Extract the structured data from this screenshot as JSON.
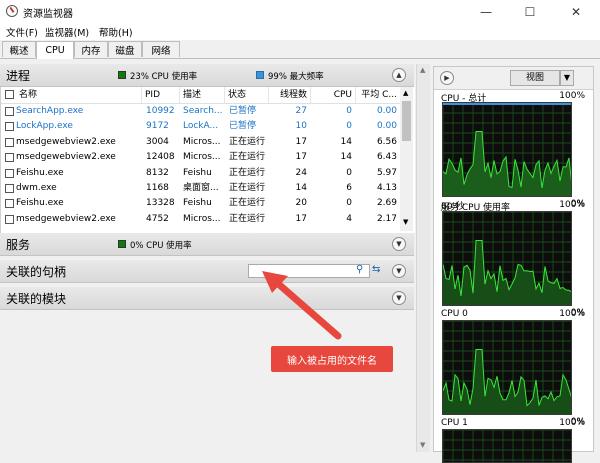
{
  "window": {
    "title": "资源监视器",
    "minimize": "—",
    "maximize": "☐",
    "close": "✕"
  },
  "menu": [
    "文件(F)",
    "监视器(M)",
    "帮助(H)"
  ],
  "tabs": [
    "概述",
    "CPU",
    "内存",
    "磁盘",
    "网络"
  ],
  "active_tab": "CPU",
  "processes": {
    "title": "进程",
    "cpu_usage": "23% CPU 使用率",
    "max_freq": "99% 最大频率",
    "columns": [
      "名称",
      "PID",
      "描述",
      "状态",
      "线程数",
      "CPU",
      "平均 C..."
    ],
    "rows": [
      {
        "name": "SearchApp.exe",
        "pid": "10992",
        "desc": "Search...",
        "status": "已暂停",
        "threads": "27",
        "cpu": "0",
        "avg": "0.00",
        "suspended": true
      },
      {
        "name": "LockApp.exe",
        "pid": "9172",
        "desc": "LockA...",
        "status": "已暂停",
        "threads": "10",
        "cpu": "0",
        "avg": "0.00",
        "suspended": true
      },
      {
        "name": "msedgewebview2.exe",
        "pid": "3004",
        "desc": "Micros...",
        "status": "正在运行",
        "threads": "17",
        "cpu": "14",
        "avg": "6.56",
        "suspended": false
      },
      {
        "name": "msedgewebview2.exe",
        "pid": "12408",
        "desc": "Micros...",
        "status": "正在运行",
        "threads": "17",
        "cpu": "14",
        "avg": "6.43",
        "suspended": false
      },
      {
        "name": "Feishu.exe",
        "pid": "8132",
        "desc": "Feishu",
        "status": "正在运行",
        "threads": "24",
        "cpu": "0",
        "avg": "5.97",
        "suspended": false
      },
      {
        "name": "dwm.exe",
        "pid": "1168",
        "desc": "桌面窗...",
        "status": "正在运行",
        "threads": "14",
        "cpu": "6",
        "avg": "4.13",
        "suspended": false
      },
      {
        "name": "Feishu.exe",
        "pid": "13328",
        "desc": "Feishu",
        "status": "正在运行",
        "threads": "20",
        "cpu": "0",
        "avg": "2.69",
        "suspended": false
      },
      {
        "name": "msedgewebview2.exe",
        "pid": "4752",
        "desc": "Micros...",
        "status": "正在运行",
        "threads": "17",
        "cpu": "4",
        "avg": "2.17",
        "suspended": false
      }
    ]
  },
  "services": {
    "title": "服务",
    "cpu_usage": "0% CPU 使用率"
  },
  "handles": {
    "title": "关联的句柄",
    "search_placeholder": ""
  },
  "modules": {
    "title": "关联的模块"
  },
  "right_panel": {
    "view_label": "视图",
    "graphs": [
      {
        "title": "CPU - 总计",
        "top": "100%",
        "bottom_left": "60 秒",
        "bottom_right": "0%"
      },
      {
        "title": "服务 CPU 使用率",
        "top": "100%",
        "bottom_left": "",
        "bottom_right": "0%"
      },
      {
        "title": "CPU 0",
        "top": "100%",
        "bottom_left": "",
        "bottom_right": "0%"
      },
      {
        "title": "CPU 1",
        "top": "100%",
        "bottom_left": "",
        "bottom_right": ""
      }
    ]
  },
  "annotation": {
    "text": "输入被占用的文件名"
  },
  "colors": {
    "green": "#0b7d0b",
    "blue_link": "#1a73c8",
    "graph_line": "#38e838",
    "annotation": "#e8473e"
  }
}
